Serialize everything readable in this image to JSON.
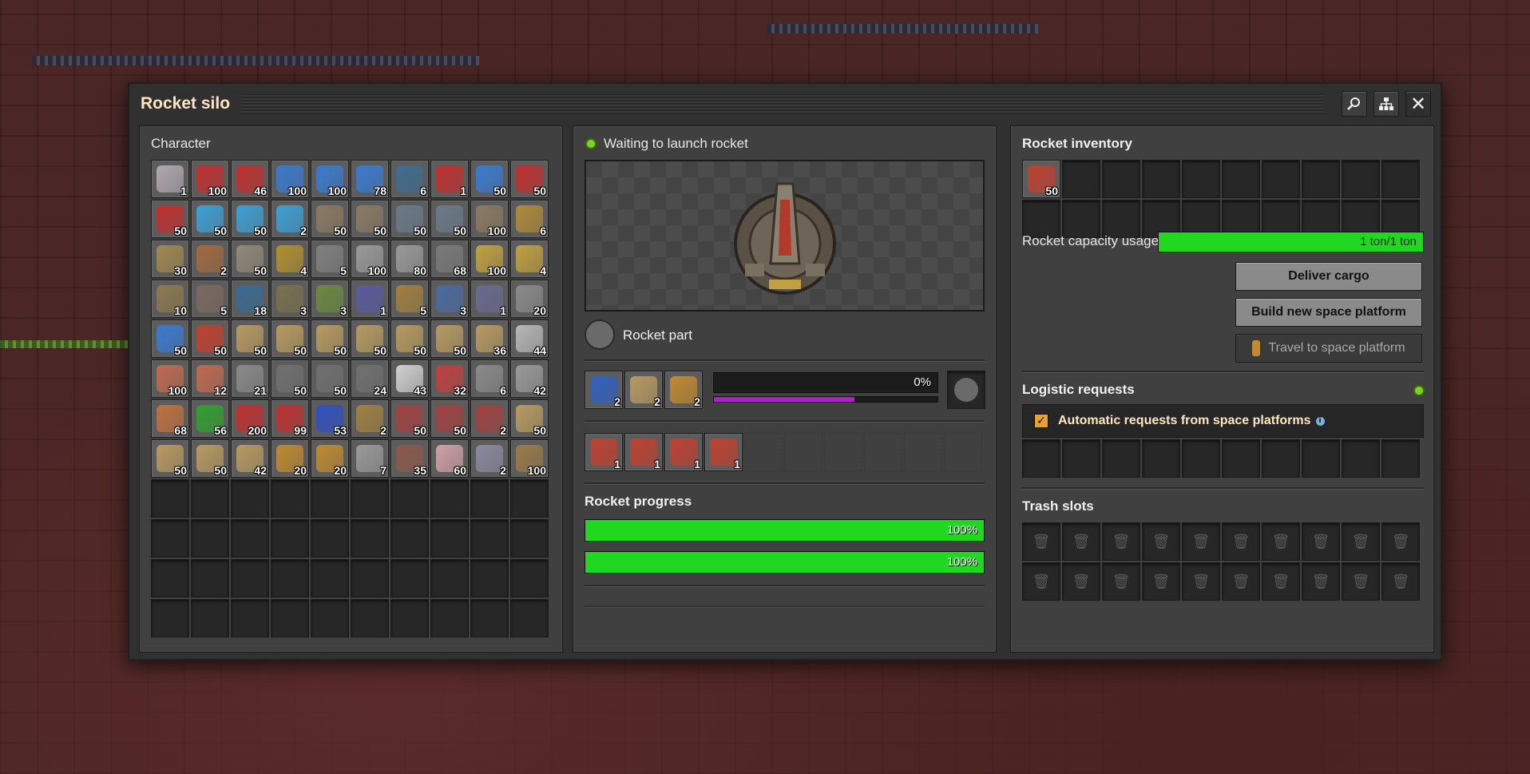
{
  "window": {
    "title": "Rocket silo",
    "search_icon": "search-icon",
    "tree_icon": "hierarchy-icon",
    "close_glyph": "✕"
  },
  "character": {
    "title": "Character",
    "rows": [
      [
        {
          "c": "#b0a9b0",
          "n": "1"
        },
        {
          "c": "#c03030",
          "n": "100"
        },
        {
          "c": "#c03030",
          "n": "46"
        },
        {
          "c": "#3a7ad0",
          "n": "100"
        },
        {
          "c": "#3a7ad0",
          "n": "100"
        },
        {
          "c": "#3a7ad0",
          "n": "78"
        },
        {
          "c": "#3f6d8f",
          "n": "6"
        },
        {
          "c": "#c03030",
          "n": "1"
        },
        {
          "c": "#3a7ad0",
          "n": "50"
        },
        {
          "c": "#c03030",
          "n": "50"
        }
      ],
      [
        {
          "c": "#c03030",
          "n": "50"
        },
        {
          "c": "#3ea0d6",
          "n": "50"
        },
        {
          "c": "#3ea0d6",
          "n": "50"
        },
        {
          "c": "#3ea0d6",
          "n": "2"
        },
        {
          "c": "#8a7a62",
          "n": "50"
        },
        {
          "c": "#8a7a62",
          "n": "50"
        },
        {
          "c": "#6a7a8a",
          "n": "50"
        },
        {
          "c": "#6a7a8a",
          "n": "50"
        },
        {
          "c": "#8a7a62",
          "n": "100"
        },
        {
          "c": "#b08a3a",
          "n": "6"
        }
      ],
      [
        {
          "c": "#a08850",
          "n": "30"
        },
        {
          "c": "#a06a40",
          "n": "2"
        },
        {
          "c": "#908878",
          "n": "50"
        },
        {
          "c": "#b09030",
          "n": "4"
        },
        {
          "c": "#808080",
          "n": "5"
        },
        {
          "c": "#9a9a9a",
          "n": "100"
        },
        {
          "c": "#9a9a9a",
          "n": "80"
        },
        {
          "c": "#7a7a7a",
          "n": "68"
        },
        {
          "c": "#c0a040",
          "n": "100"
        },
        {
          "c": "#c0a040",
          "n": "4"
        }
      ],
      [
        {
          "c": "#8a7a50",
          "n": "10"
        },
        {
          "c": "#7a6a60",
          "n": "5"
        },
        {
          "c": "#3a6a90",
          "n": "18"
        },
        {
          "c": "#7a7050",
          "n": "3"
        },
        {
          "c": "#6a8a40",
          "n": "3"
        },
        {
          "c": "#5a5aa0",
          "n": "1"
        },
        {
          "c": "#a08040",
          "n": "5"
        },
        {
          "c": "#4a6aa0",
          "n": "3"
        },
        {
          "c": "#6a6a90",
          "n": "1"
        },
        {
          "c": "#8a8a8a",
          "n": "20"
        }
      ],
      [
        {
          "c": "#3a7ad0",
          "n": "50"
        },
        {
          "c": "#c04030",
          "n": "50"
        },
        {
          "c": "#b89a60",
          "n": "50"
        },
        {
          "c": "#b89a60",
          "n": "50"
        },
        {
          "c": "#b89a60",
          "n": "50"
        },
        {
          "c": "#b89a60",
          "n": "50"
        },
        {
          "c": "#b89a60",
          "n": "50"
        },
        {
          "c": "#b89a60",
          "n": "50"
        },
        {
          "c": "#b89a60",
          "n": "36"
        },
        {
          "c": "#b8b8b8",
          "n": "44"
        }
      ],
      [
        {
          "c": "#c06a50",
          "n": "100"
        },
        {
          "c": "#c06a50",
          "n": "12"
        },
        {
          "c": "#8a8a8a",
          "n": "21"
        },
        {
          "c": "#707070",
          "n": "50"
        },
        {
          "c": "#707070",
          "n": "50"
        },
        {
          "c": "#707070",
          "n": "24"
        },
        {
          "c": "#d0d0d0",
          "n": "43"
        },
        {
          "c": "#c04040",
          "n": "32"
        },
        {
          "c": "#8a8a8a",
          "n": "6"
        },
        {
          "c": "#9a9a9a",
          "n": "42"
        }
      ],
      [
        {
          "c": "#c07040",
          "n": "68"
        },
        {
          "c": "#30a030",
          "n": "56"
        },
        {
          "c": "#c03030",
          "n": "200"
        },
        {
          "c": "#c03030",
          "n": "99"
        },
        {
          "c": "#3050c0",
          "n": "53"
        },
        {
          "c": "#a08040",
          "n": "2"
        },
        {
          "c": "#a04040",
          "n": "50"
        },
        {
          "c": "#a04040",
          "n": "50"
        },
        {
          "c": "#a04040",
          "n": "2"
        },
        {
          "c": "#b89a60",
          "n": "50"
        }
      ],
      [
        {
          "c": "#b89a60",
          "n": "50"
        },
        {
          "c": "#b89a60",
          "n": "50"
        },
        {
          "c": "#b89a60",
          "n": "42"
        },
        {
          "c": "#c08a30",
          "n": "20"
        },
        {
          "c": "#c08a30",
          "n": "20"
        },
        {
          "c": "#9a9a9a",
          "n": "7"
        },
        {
          "c": "#8a5a4a",
          "n": "35"
        },
        {
          "c": "#d0a0a8",
          "n": "60"
        },
        {
          "c": "#8a8aa0",
          "n": "2"
        },
        {
          "c": "#9a7a4a",
          "n": "100"
        }
      ]
    ],
    "empty_rows": 4
  },
  "silo": {
    "status": "Waiting to launch rocket",
    "recipe_label": "Rocket part",
    "ingredients": [
      {
        "c": "#3060c0",
        "n": "2"
      },
      {
        "c": "#b89a60",
        "n": "2"
      },
      {
        "c": "#c08a30",
        "n": "2"
      }
    ],
    "craft_percent_label": "0%",
    "craft_progress": 0,
    "secondary_progress": 0.63,
    "outputs": [
      {
        "c": "#c04030",
        "n": "1"
      },
      {
        "c": "#c04030",
        "n": "1"
      },
      {
        "c": "#c04030",
        "n": "1"
      },
      {
        "c": "#c04030",
        "n": "1"
      }
    ],
    "rocket_progress_title": "Rocket progress",
    "bars": [
      {
        "label": "100%",
        "value": 1.0
      },
      {
        "label": "100%",
        "value": 1.0
      }
    ]
  },
  "rocket": {
    "inventory_title": "Rocket inventory",
    "inventory": [
      {
        "c": "#c04030",
        "n": "50"
      }
    ],
    "capacity_label": "Rocket capacity usage",
    "capacity_text": "1 ton/1 ton",
    "capacity_value": 1.0,
    "deliver": "Deliver cargo",
    "build": "Build new space platform",
    "travel": "Travel to space platform",
    "logistic_title": "Logistic requests",
    "auto_requests": "Automatic requests from space platforms",
    "trash_title": "Trash slots"
  },
  "colors": {
    "accent_green": "#1fd81f",
    "purple": "#b020c8",
    "title": "#ffe6c0"
  }
}
